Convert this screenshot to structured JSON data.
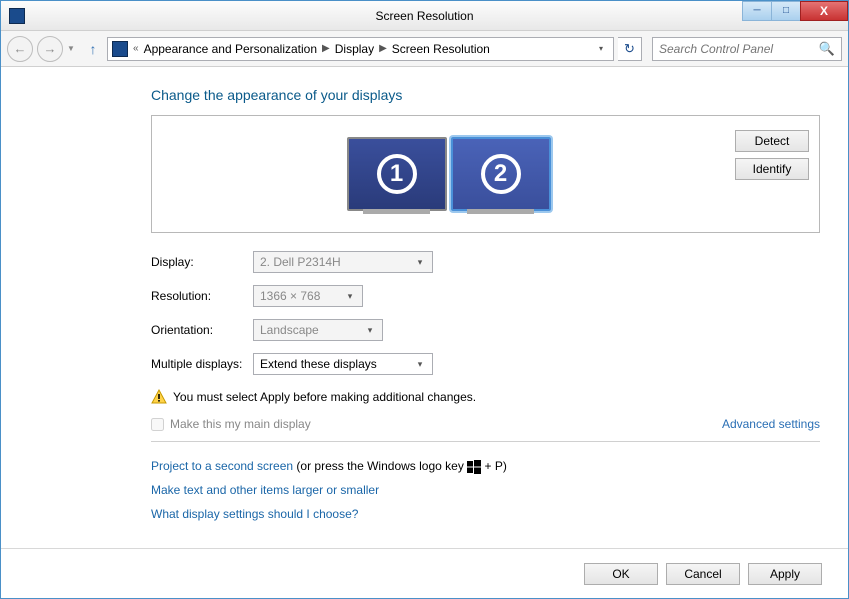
{
  "window": {
    "title": "Screen Resolution",
    "controls": {
      "minimize": "─",
      "maximize": "□",
      "close": "X"
    }
  },
  "navbar": {
    "back": "←",
    "forward": "→",
    "up": "↑",
    "breadcrumb_prefix": "«",
    "breadcrumbs": [
      "Appearance and Personalization",
      "Display",
      "Screen Resolution"
    ],
    "refresh": "↻",
    "search_placeholder": "Search Control Panel"
  },
  "page": {
    "title": "Change the appearance of your displays",
    "monitors": [
      {
        "num": "1",
        "selected": false
      },
      {
        "num": "2",
        "selected": true
      }
    ],
    "detect": "Detect",
    "identify": "Identify",
    "labels": {
      "display": "Display:",
      "resolution": "Resolution:",
      "orientation": "Orientation:",
      "multiple": "Multiple displays:"
    },
    "values": {
      "display": "2. Dell P2314H",
      "resolution": "1366 × 768",
      "orientation": "Landscape",
      "multiple": "Extend these displays"
    },
    "warning": "You must select Apply before making additional changes.",
    "main_display_checkbox": "Make this my main display",
    "advanced": "Advanced settings",
    "project_link": "Project to a second screen",
    "project_suffix_a": " (or press the Windows logo key ",
    "project_suffix_b": " + P)",
    "textsize_link": "Make text and other items larger or smaller",
    "choose_link": "What display settings should I choose?"
  },
  "footer": {
    "ok": "OK",
    "cancel": "Cancel",
    "apply": "Apply"
  }
}
